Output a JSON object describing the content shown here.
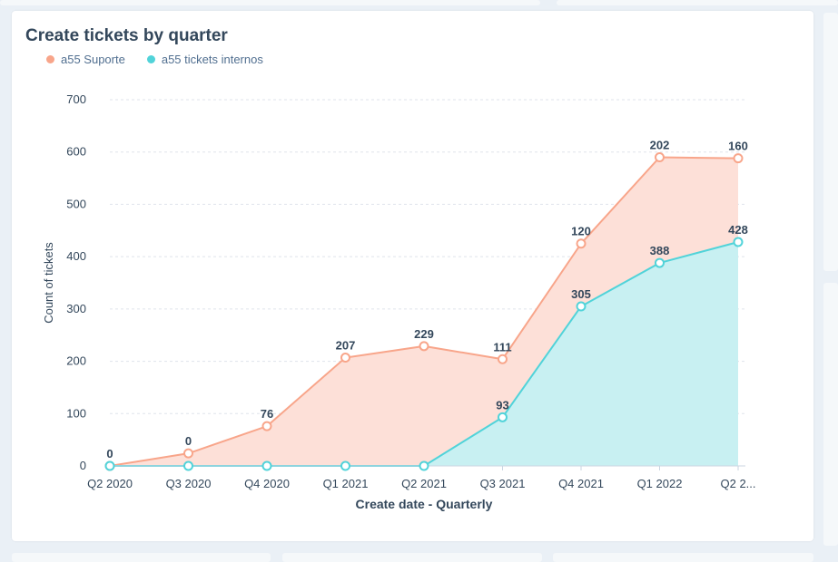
{
  "chart_data": {
    "type": "area",
    "title": "Create tickets by quarter",
    "xlabel": "Create date - Quarterly",
    "ylabel": "Count of tickets",
    "ylim": [
      0,
      700
    ],
    "yticks": [
      0,
      100,
      200,
      300,
      400,
      500,
      600,
      700
    ],
    "grid": true,
    "legend_position": "top-left",
    "stacked": true,
    "categories": [
      "Q2 2020",
      "Q3 2020",
      "Q4 2020",
      "Q1 2021",
      "Q2 2021",
      "Q3 2021",
      "Q4 2021",
      "Q1 2022",
      "Q2 2..."
    ],
    "series": [
      {
        "name": "a55 Suporte",
        "color": "#ff8f59",
        "line_color": "#f8a58a",
        "fill_color": "#fde0d8",
        "values": [
          0,
          0,
          76,
          207,
          229,
          111,
          120,
          202,
          160
        ]
      },
      {
        "name": "a55 tickets internos",
        "color": "#00bda5",
        "line_color": "#51d3d9",
        "fill_color": "#c8f0f2",
        "values": [
          0,
          0,
          0,
          0,
          0,
          93,
          305,
          388,
          428
        ]
      }
    ],
    "stack_totals": [
      0,
      24,
      76,
      207,
      229,
      204,
      425,
      590,
      588
    ]
  }
}
